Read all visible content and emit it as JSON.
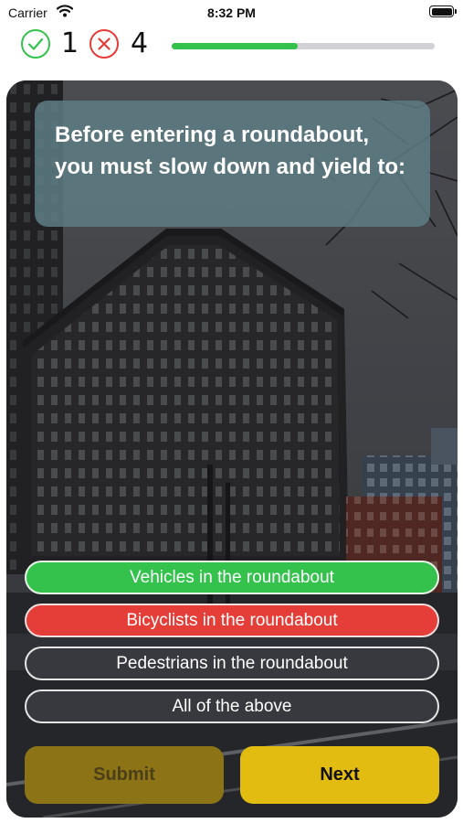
{
  "status": {
    "carrier": "Carrier",
    "time": "8:32 PM"
  },
  "score": {
    "correct": "1",
    "wrong": "4",
    "progress_fraction": 0.48
  },
  "question": {
    "text": "Before entering a roundabout, you must slow down and yield to:"
  },
  "answers": [
    {
      "label": "Vehicles in the roundabout",
      "state": "correct"
    },
    {
      "label": "Bicyclists in the roundabout",
      "state": "wrong"
    },
    {
      "label": "Pedestrians in the roundabout",
      "state": "neutral"
    },
    {
      "label": "All of the above",
      "state": "neutral"
    }
  ],
  "buttons": {
    "submit": "Submit",
    "next": "Next"
  },
  "colors": {
    "correct": "#34c24d",
    "wrong": "#e53d37",
    "next": "#e2bc10",
    "submit_disabled": "#8c7416"
  }
}
